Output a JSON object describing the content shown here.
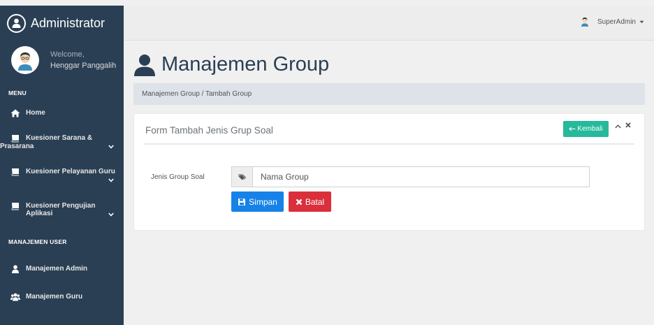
{
  "sidebar": {
    "brand": "Administrator",
    "welcome": "Welcome,",
    "user_name": "Henggar Panggalih",
    "menu_title": "MENU",
    "items": [
      {
        "label": "Home"
      },
      {
        "label_line1": "Kuesioner Sarana &",
        "label_line2": "Prasarana"
      },
      {
        "label": "Kuesioner Pelayanan Guru"
      },
      {
        "label": "Kuesioner Pengujian Aplikasi"
      }
    ],
    "user_section_title": "MANAJEMEN USER",
    "user_items": [
      {
        "label": "Manajemen Admin"
      },
      {
        "label": "Manajemen Guru"
      }
    ]
  },
  "topbar": {
    "user": "SuperAdmin"
  },
  "main": {
    "title": "Manajemen Group",
    "breadcrumb": "Manajemen Group / Tambah Group"
  },
  "panel": {
    "title": "Form Tambah Jenis Grup Soal",
    "back_label": "Kembali",
    "field_label": "Jenis Group Soal",
    "field_placeholder": "Nama Group",
    "save_label": "Simpan",
    "cancel_label": "Batal"
  },
  "colors": {
    "sidebar": "#2a3f54",
    "success": "#26b99a",
    "primary": "#1682e8",
    "danger": "#d9303b"
  },
  "icons": {
    "brand": "user-icon",
    "home": "home-icon",
    "menu_book": "book-icon",
    "admin": "user-icon",
    "guru": "users-icon",
    "tag": "tag-icon",
    "save": "save-icon",
    "cancel": "times-icon"
  }
}
